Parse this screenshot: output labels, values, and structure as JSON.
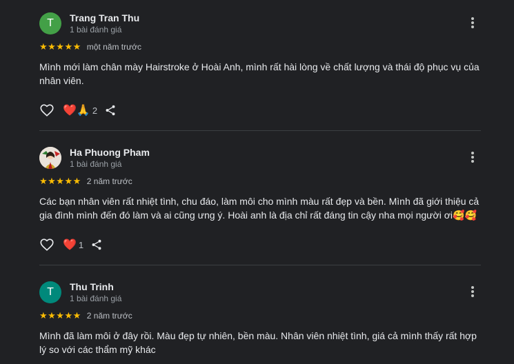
{
  "colors": {
    "background": "#202124",
    "star": "#fbbc04",
    "avatar_r1": "#43a047",
    "avatar_r3": "#00897b"
  },
  "reviews": [
    {
      "avatar_letter": "T",
      "name": "Trang Tran Thu",
      "review_count": "1 bài đánh giá",
      "stars": "★★★★★",
      "rating": 5,
      "time": "một năm trước",
      "text": "Mình mới làm chân mày Hairstroke ở Hoài Anh, mình rất hài lòng về chất lượng và thái độ phục vụ của nhân viên.",
      "reactions": "❤️🙏",
      "reaction_count": "2"
    },
    {
      "avatar_letter": "",
      "name": "Ha Phuong Pham",
      "review_count": "1 bài đánh giá",
      "stars": "★★★★★",
      "rating": 5,
      "time": "2 năm trước",
      "text": "Các bạn nhân viên rất nhiệt tình, chu đáo, làm môi cho mình màu rất đẹp và bền. Mình đã giới thiệu cả gia đình mình đến đó làm và ai cũng ưng ý. Hoài anh là địa chỉ rất đáng tin cậy nha mọi người ơi🥰🥰",
      "reactions": "❤️",
      "reaction_count": "1"
    },
    {
      "avatar_letter": "T",
      "name": "Thu Trinh",
      "review_count": "1 bài đánh giá",
      "stars": "★★★★★",
      "rating": 5,
      "time": "2 năm trước",
      "text": "Mình đã làm môi ở đây rồi. Màu đẹp tự nhiên, bền màu. Nhân viên nhiệt tình, giá cả mình thấy rất hợp lý so với các thẩm mỹ khác"
    }
  ]
}
